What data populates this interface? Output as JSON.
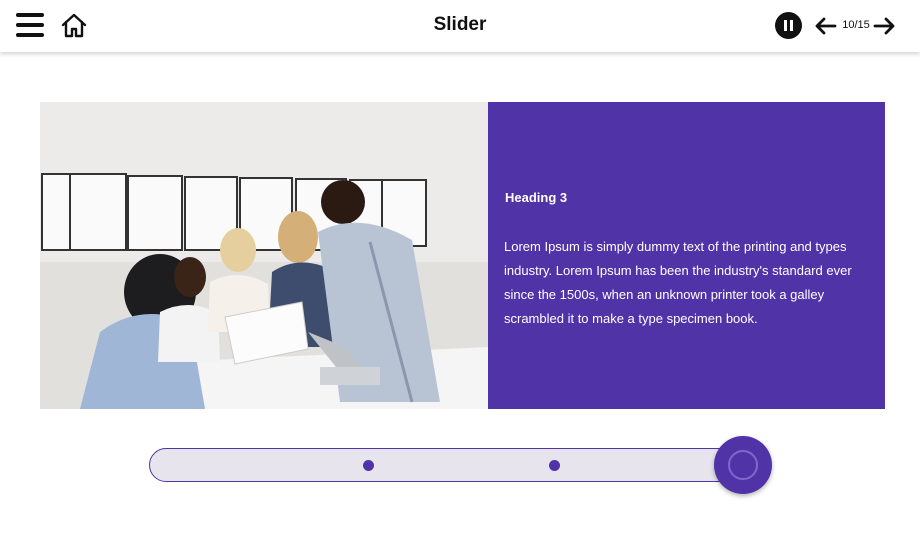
{
  "header": {
    "title": "Slider",
    "page_counter": "10/15",
    "icons": {
      "menu": "menu-icon",
      "home": "home-icon",
      "pause": "pause-icon",
      "prev": "arrow-left-icon",
      "next": "arrow-right-icon"
    }
  },
  "slide": {
    "image": "office-team-photo",
    "heading": "Heading 3",
    "body": "Lorem Ipsum is simply dummy text of the printing and types industry. Lorem Ipsum has been the industry's standard ever since the 1500s, when an unknown printer took a galley scrambled it to make a type specimen book."
  },
  "slider": {
    "dots": 2,
    "position": "end"
  },
  "colors": {
    "accent": "#5133a8",
    "track": "#e8e4ee",
    "text_on_accent": "#ffffff"
  }
}
